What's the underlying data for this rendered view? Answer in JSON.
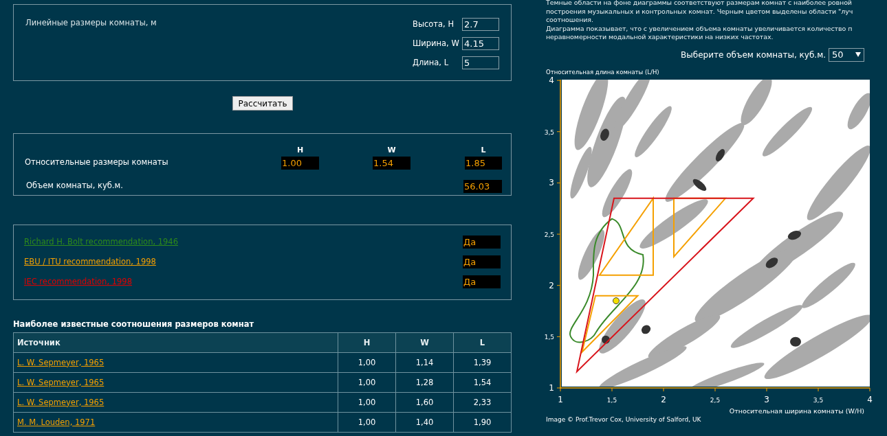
{
  "dimensions": {
    "title": "Линейные размеры комнаты, м",
    "fields": [
      {
        "label": "Высота, H",
        "value": "2.7"
      },
      {
        "label": "Ширина, W",
        "value": "4.15"
      },
      {
        "label": "Длина, L",
        "value": "5"
      }
    ]
  },
  "calculate_button": "Рассчитать",
  "relative": {
    "columns": [
      "H",
      "W",
      "L"
    ],
    "label": "Относительные размеры комнаты",
    "values": [
      "1.00",
      "1.54",
      "1.85"
    ],
    "volume_label": "Объем комнаты, куб.м.",
    "volume": "56.03"
  },
  "recommendations": [
    {
      "label": "Richard H. Bolt recommendation, 1946",
      "color": "#2e8b1a",
      "result": "Да"
    },
    {
      "label": "EBU / ITU recommendation, 1998",
      "color": "#f5a000",
      "result": "Да"
    },
    {
      "label": "IEC recommendation, 1998",
      "color": "#e00000",
      "result": "Да"
    }
  ],
  "ratios_table": {
    "title": "Наиболее известные соотношения размеров комнат",
    "columns": [
      "Источник",
      "H",
      "W",
      "L"
    ],
    "rows": [
      [
        "L. W. Sepmeyer, 1965",
        "1,00",
        "1,14",
        "1,39"
      ],
      [
        "L. W. Sepmeyer, 1965",
        "1,00",
        "1,28",
        "1,54"
      ],
      [
        "L. W. Sepmeyer, 1965",
        "1,00",
        "1,60",
        "2,33"
      ],
      [
        "M. M. Louden, 1971",
        "1,00",
        "1,40",
        "1,90"
      ]
    ]
  },
  "description": {
    "lines": [
      "Темные области на фоне диаграммы соответствуют размерам комнат с наиболее ровной",
      "построения музыкальных и контрольных комнат. Черным цветом выделены области \"луч",
      "соотношения.",
      "Диаграмма показывает, что с увеличением объема комнаты увеличивается количество п",
      "неравномерности модальной характеристики на низких частотах."
    ]
  },
  "volume_select": {
    "label": "Выберите объем комнаты, куб.м.",
    "value": "50"
  },
  "diagram": {
    "ylabel": "Относительная длина комнаты (L/H)",
    "xlabel": "Относительная ширина комнаты (W/H)",
    "xticks": [
      "1",
      "1,5",
      "2",
      "2,5",
      "3",
      "3,5",
      "4"
    ],
    "yticks": [
      "4",
      "3,5",
      "3",
      "2,5",
      "2",
      "1,5",
      "1"
    ],
    "credit": "Image © Prof.Trevor Cox, University of Salford, UK"
  }
}
